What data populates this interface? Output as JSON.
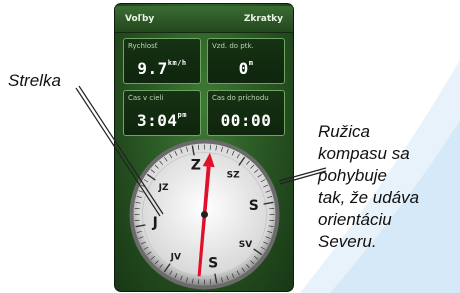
{
  "softkeys": {
    "left": "Voľby",
    "right": "Zkratky"
  },
  "fields": [
    {
      "label": "Rychlosť",
      "value": "9.7",
      "unit": "km/h"
    },
    {
      "label": "Vzd. do ptk.",
      "value": "0",
      "unit": "m"
    },
    {
      "label": "Čas v cieli",
      "value": "3:04",
      "unit": "pm"
    },
    {
      "label": "Čas do príchodu",
      "value": "00:00",
      "unit": ""
    }
  ],
  "compass": {
    "cardinals": [
      "S",
      "JV",
      "J",
      "JZ",
      "Z",
      "SZ",
      "S",
      "SV"
    ],
    "needle_color": "#e0102a"
  },
  "callouts": {
    "left": "Strelka",
    "right": [
      "Ružica",
      "kompasu sa",
      "pohybuje",
      "tak, že udáva",
      "orientáciu",
      "Severu."
    ]
  }
}
